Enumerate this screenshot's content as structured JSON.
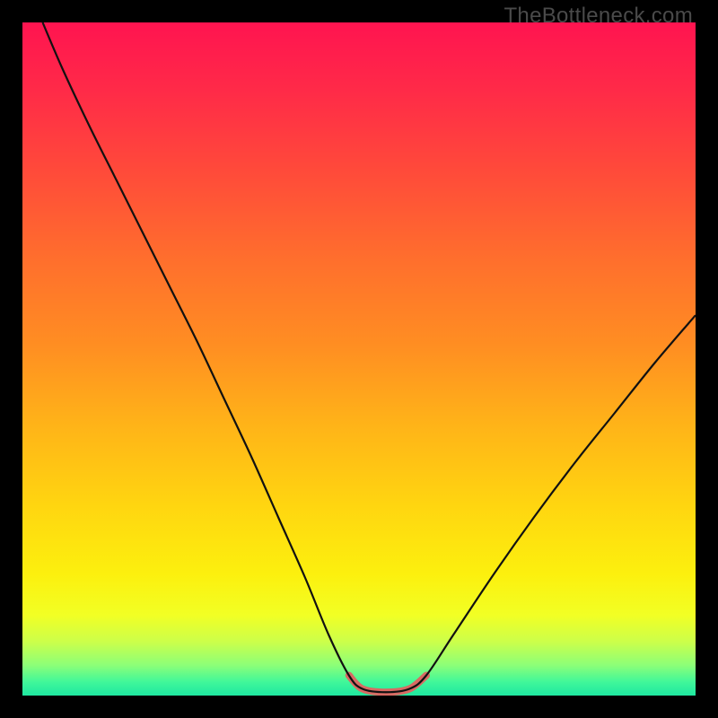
{
  "watermark": "TheBottleneck.com",
  "gradient_stops": [
    {
      "offset": 0.0,
      "color": "#ff1450"
    },
    {
      "offset": 0.1,
      "color": "#ff2a48"
    },
    {
      "offset": 0.22,
      "color": "#ff4a3a"
    },
    {
      "offset": 0.35,
      "color": "#ff6e2d"
    },
    {
      "offset": 0.48,
      "color": "#ff8e22"
    },
    {
      "offset": 0.6,
      "color": "#ffb418"
    },
    {
      "offset": 0.72,
      "color": "#ffd610"
    },
    {
      "offset": 0.82,
      "color": "#fcf00e"
    },
    {
      "offset": 0.88,
      "color": "#f2ff24"
    },
    {
      "offset": 0.92,
      "color": "#ccff4a"
    },
    {
      "offset": 0.955,
      "color": "#8cff78"
    },
    {
      "offset": 0.98,
      "color": "#40f79a"
    },
    {
      "offset": 1.0,
      "color": "#1ee8a0"
    }
  ],
  "chart_data": {
    "type": "line",
    "title": "",
    "xlabel": "",
    "ylabel": "",
    "xlim": [
      0,
      100
    ],
    "ylim": [
      0,
      100
    ],
    "series": [
      {
        "name": "bottleneck-curve",
        "stroke": "#111111",
        "stroke_width": 2.2,
        "points": [
          {
            "x": 3.0,
            "y": 100.0
          },
          {
            "x": 6.0,
            "y": 93.0
          },
          {
            "x": 10.0,
            "y": 84.5
          },
          {
            "x": 14.0,
            "y": 76.5
          },
          {
            "x": 18.0,
            "y": 68.5
          },
          {
            "x": 22.0,
            "y": 60.5
          },
          {
            "x": 26.0,
            "y": 52.5
          },
          {
            "x": 30.0,
            "y": 44.0
          },
          {
            "x": 34.0,
            "y": 35.5
          },
          {
            "x": 38.0,
            "y": 26.5
          },
          {
            "x": 42.0,
            "y": 17.5
          },
          {
            "x": 45.5,
            "y": 9.0
          },
          {
            "x": 48.5,
            "y": 3.0
          },
          {
            "x": 50.5,
            "y": 1.0
          },
          {
            "x": 54.0,
            "y": 0.5
          },
          {
            "x": 57.5,
            "y": 1.0
          },
          {
            "x": 60.0,
            "y": 3.0
          },
          {
            "x": 64.0,
            "y": 9.0
          },
          {
            "x": 70.0,
            "y": 18.0
          },
          {
            "x": 76.0,
            "y": 26.5
          },
          {
            "x": 82.0,
            "y": 34.5
          },
          {
            "x": 88.0,
            "y": 42.0
          },
          {
            "x": 94.0,
            "y": 49.5
          },
          {
            "x": 100.0,
            "y": 56.5
          }
        ]
      },
      {
        "name": "optimal-band",
        "stroke": "#d86a63",
        "stroke_width": 8,
        "cap": "round",
        "points": [
          {
            "x": 48.5,
            "y": 3.0
          },
          {
            "x": 50.5,
            "y": 1.0
          },
          {
            "x": 54.0,
            "y": 0.5
          },
          {
            "x": 57.5,
            "y": 1.0
          },
          {
            "x": 60.0,
            "y": 3.0
          }
        ]
      }
    ]
  }
}
